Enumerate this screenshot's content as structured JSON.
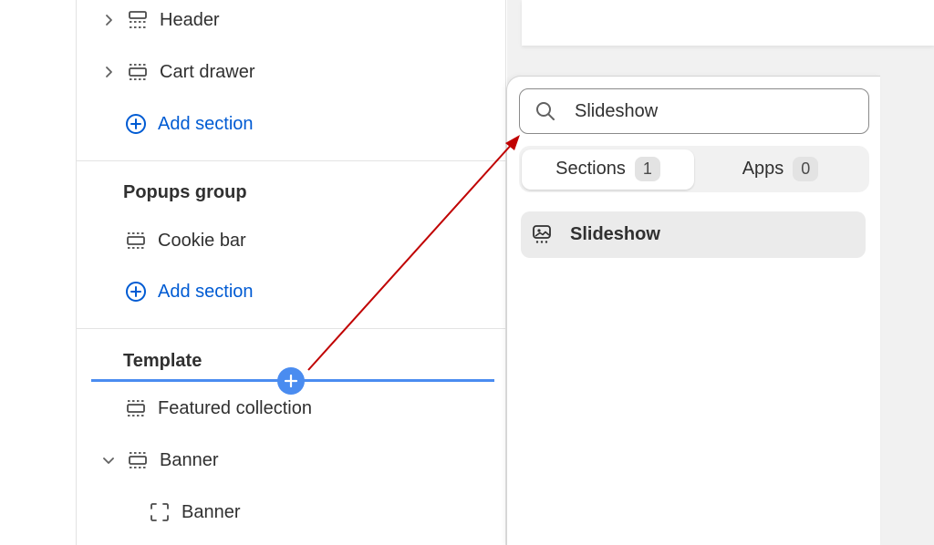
{
  "sidebar": {
    "header_group": [
      {
        "label": "Header"
      },
      {
        "label": "Cart drawer"
      }
    ],
    "add_section_label": "Add section",
    "popups_group": {
      "title": "Popups group",
      "items": [
        {
          "label": "Cookie bar"
        }
      ],
      "add_section_label": "Add section"
    },
    "template": {
      "title": "Template",
      "items": [
        {
          "label": "Featured collection"
        },
        {
          "label": "Banner"
        }
      ],
      "banner_block": {
        "label": "Banner"
      }
    }
  },
  "picker": {
    "search": {
      "value": "Slideshow",
      "placeholder": "Search"
    },
    "tabs": [
      {
        "label": "Sections",
        "count": "1"
      },
      {
        "label": "Apps",
        "count": "0"
      }
    ],
    "results": [
      {
        "label": "Slideshow"
      }
    ]
  },
  "colors": {
    "accent_blue": "#005bd3",
    "insert_line": "#4a8cf0",
    "annotation_arrow": "#c00000"
  }
}
